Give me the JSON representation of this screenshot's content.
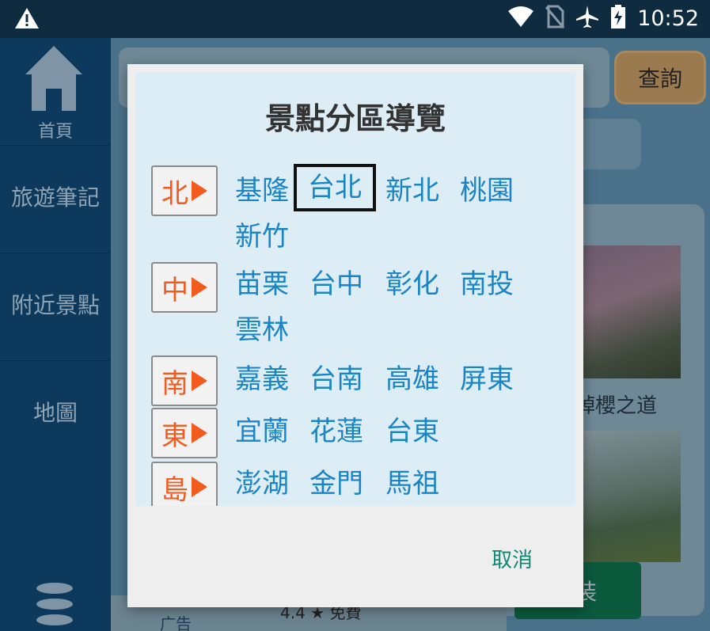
{
  "status_bar": {
    "time": "10:52",
    "icons": [
      "warning-icon",
      "wifi-icon",
      "no-sim-icon",
      "airplane-icon",
      "battery-charging-icon"
    ]
  },
  "sidenav": {
    "home_label": "首頁",
    "items": [
      "旅遊筆記",
      "附近景點",
      "地圖"
    ]
  },
  "background": {
    "query_label": "查詢",
    "photo_caption": "綽櫻之道",
    "install_label": "裝",
    "ad_label": "广告",
    "rating_text": "4.4 ★ 免費"
  },
  "dialog": {
    "title": "景點分區導覽",
    "regions": [
      {
        "label": "北",
        "cities": [
          "基隆",
          "台北",
          "新北",
          "桃園",
          "新竹"
        ]
      },
      {
        "label": "中",
        "cities": [
          "苗栗",
          "台中",
          "彰化",
          "南投",
          "雲林"
        ]
      },
      {
        "label": "南",
        "cities": [
          "嘉義",
          "台南",
          "高雄",
          "屏東"
        ]
      },
      {
        "label": "東",
        "cities": [
          "宜蘭",
          "花蓮",
          "台東"
        ]
      },
      {
        "label": "島",
        "cities": [
          "澎湖",
          "金門",
          "馬祖"
        ]
      }
    ],
    "selected_city": "台北",
    "cancel_label": "取消"
  },
  "colors": {
    "accent": "#1a84c4",
    "region": "#f25a1e",
    "cancel": "#0a8a74",
    "dialog_bg": "#dcedf5"
  }
}
